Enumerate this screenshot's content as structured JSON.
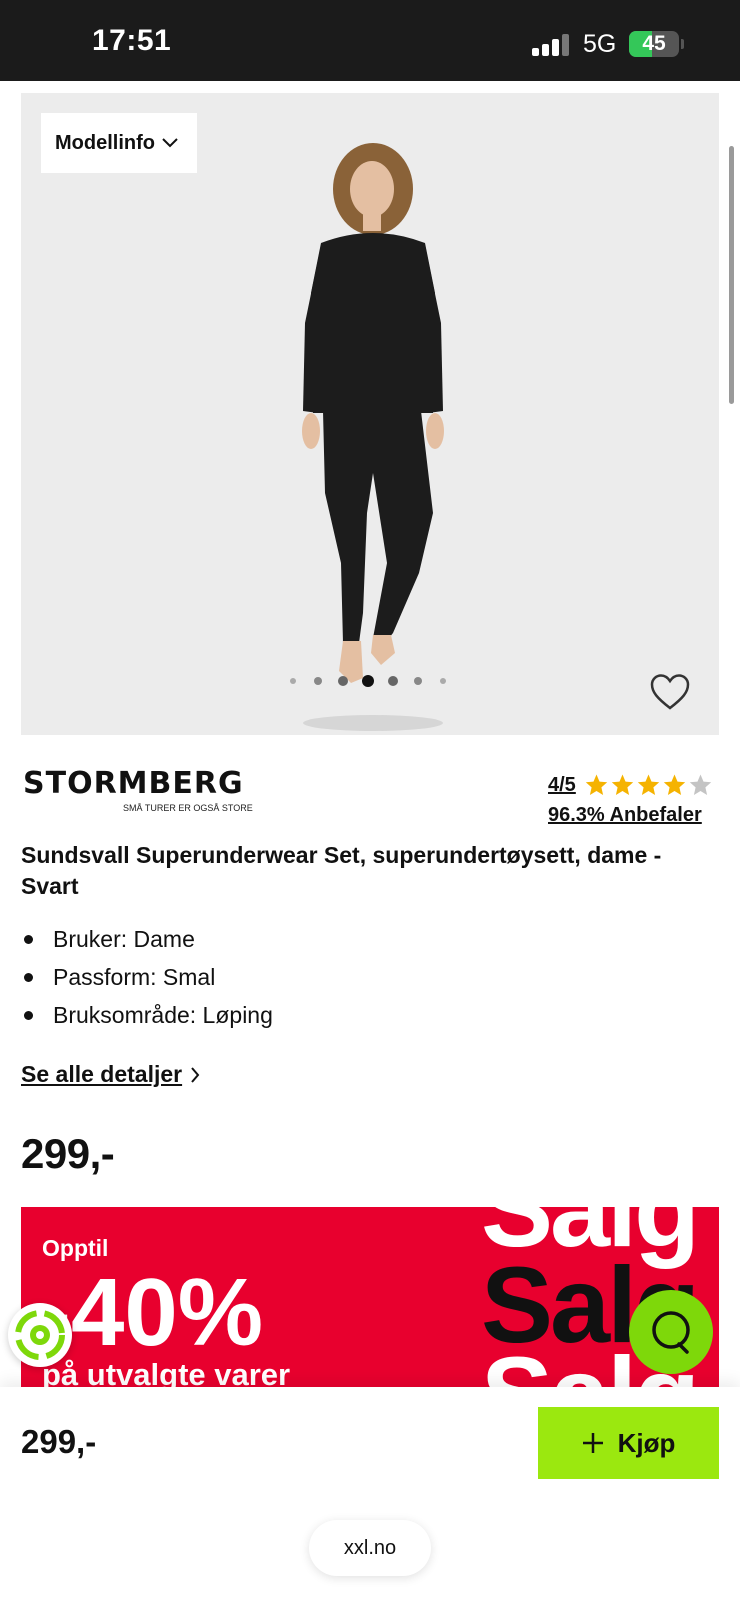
{
  "status_bar": {
    "time": "17:51",
    "network": "5G",
    "battery": "45",
    "battery_fraction": 0.45
  },
  "gallery": {
    "model_info_label": "Modellinfo",
    "image_count": 7,
    "active_image": 4
  },
  "brand": {
    "name": "STORMBERG",
    "tagline": "SMÅ TURER ER OGSÅ STORE"
  },
  "rating": {
    "score": "4/5",
    "stars_filled": 4,
    "stars_total": 5,
    "recommend": "96.3% Anbefaler",
    "star_color": "#f5b301",
    "star_empty_color": "#c4c4c4"
  },
  "product": {
    "title": "Sundsvall Superunderwear Set, superundertøysett, dame - Svart",
    "features": [
      "Bruker: Dame",
      "Passform: Smal",
      "Bruksområde: Løping"
    ],
    "details_link": "Se alle detaljer",
    "price": "299,-"
  },
  "banner": {
    "upto": "Opptil",
    "percent": "-40%",
    "subtitle": "på utvalgte varer",
    "salg": "Salg",
    "bg_color": "#e8002e"
  },
  "bottom_bar": {
    "price": "299,-",
    "buy_label": "Kjøp",
    "buy_color": "#9be80f"
  },
  "browser": {
    "url": "xxl.no"
  }
}
